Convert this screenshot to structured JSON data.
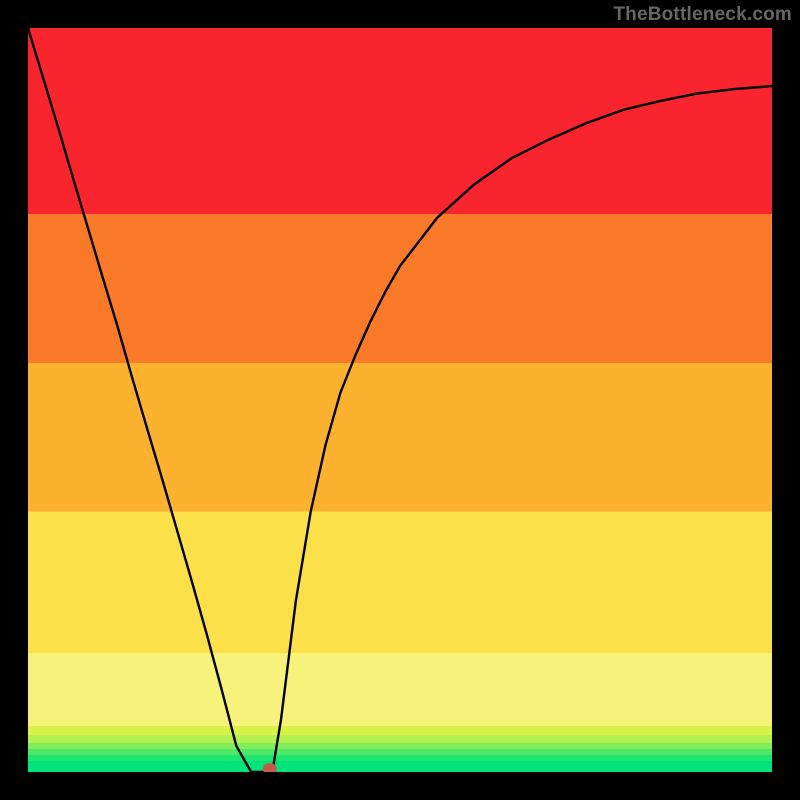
{
  "watermark": "TheBottleneck.com",
  "chart_data": {
    "type": "line",
    "x": [
      0.0,
      0.02,
      0.04,
      0.06,
      0.08,
      0.1,
      0.12,
      0.14,
      0.16,
      0.18,
      0.2,
      0.22,
      0.24,
      0.26,
      0.28,
      0.3,
      0.31,
      0.32,
      0.33,
      0.34,
      0.35,
      0.36,
      0.38,
      0.4,
      0.42,
      0.44,
      0.46,
      0.48,
      0.5,
      0.55,
      0.6,
      0.65,
      0.7,
      0.75,
      0.8,
      0.85,
      0.9,
      0.95,
      1.0
    ],
    "values": [
      1.0,
      0.934,
      0.868,
      0.8,
      0.733,
      0.666,
      0.6,
      0.53,
      0.462,
      0.395,
      0.326,
      0.257,
      0.186,
      0.112,
      0.035,
      0.0,
      0.0,
      0.0,
      0.01,
      0.07,
      0.15,
      0.23,
      0.35,
      0.44,
      0.51,
      0.56,
      0.605,
      0.645,
      0.68,
      0.745,
      0.79,
      0.825,
      0.85,
      0.872,
      0.89,
      0.902,
      0.912,
      0.918,
      0.922
    ],
    "title": "",
    "xlabel": "",
    "ylabel": "",
    "xlim": [
      0,
      1
    ],
    "ylim": [
      0,
      1
    ],
    "marker": {
      "x": 0.325,
      "y": 0.0,
      "color": "#c85a4a"
    },
    "background_bands": [
      {
        "y0": 0.0,
        "y1": 0.015,
        "color": "#00e27a"
      },
      {
        "y0": 0.015,
        "y1": 0.023,
        "color": "#1fe670"
      },
      {
        "y0": 0.023,
        "y1": 0.031,
        "color": "#4fe866"
      },
      {
        "y0": 0.031,
        "y1": 0.039,
        "color": "#7fed5c"
      },
      {
        "y0": 0.039,
        "y1": 0.05,
        "color": "#b3f050"
      },
      {
        "y0": 0.05,
        "y1": 0.062,
        "color": "#d9f247"
      },
      {
        "y0": 0.062,
        "y1": 0.16,
        "color": "#f7f27a"
      },
      {
        "y0": 0.16,
        "y1": 0.35,
        "color": "#fbe04a"
      },
      {
        "y0": 0.35,
        "y1": 0.55,
        "color": "#fcb22f"
      },
      {
        "y0": 0.55,
        "y1": 0.75,
        "color": "#fb7a2a"
      },
      {
        "y0": 0.75,
        "y1": 1.0,
        "color": "#f9252e"
      }
    ]
  }
}
